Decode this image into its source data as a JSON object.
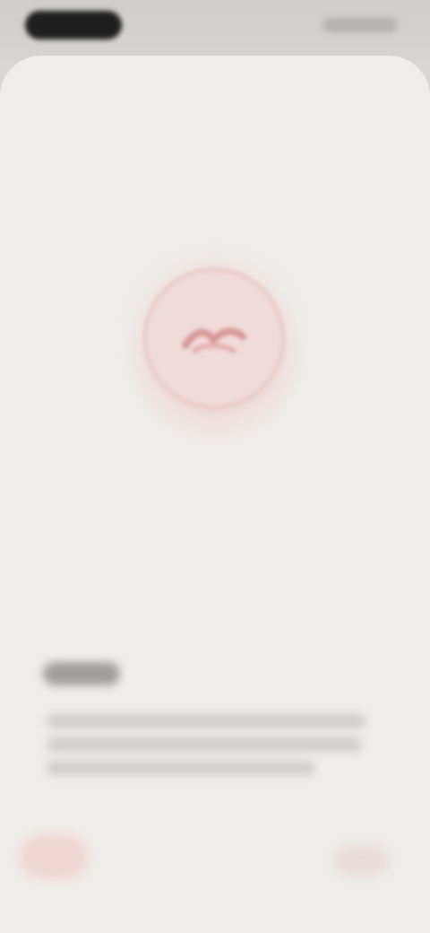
{
  "onboarding": {
    "icon": "hand-wave-icon",
    "accent_color": "#e7b4b4"
  }
}
